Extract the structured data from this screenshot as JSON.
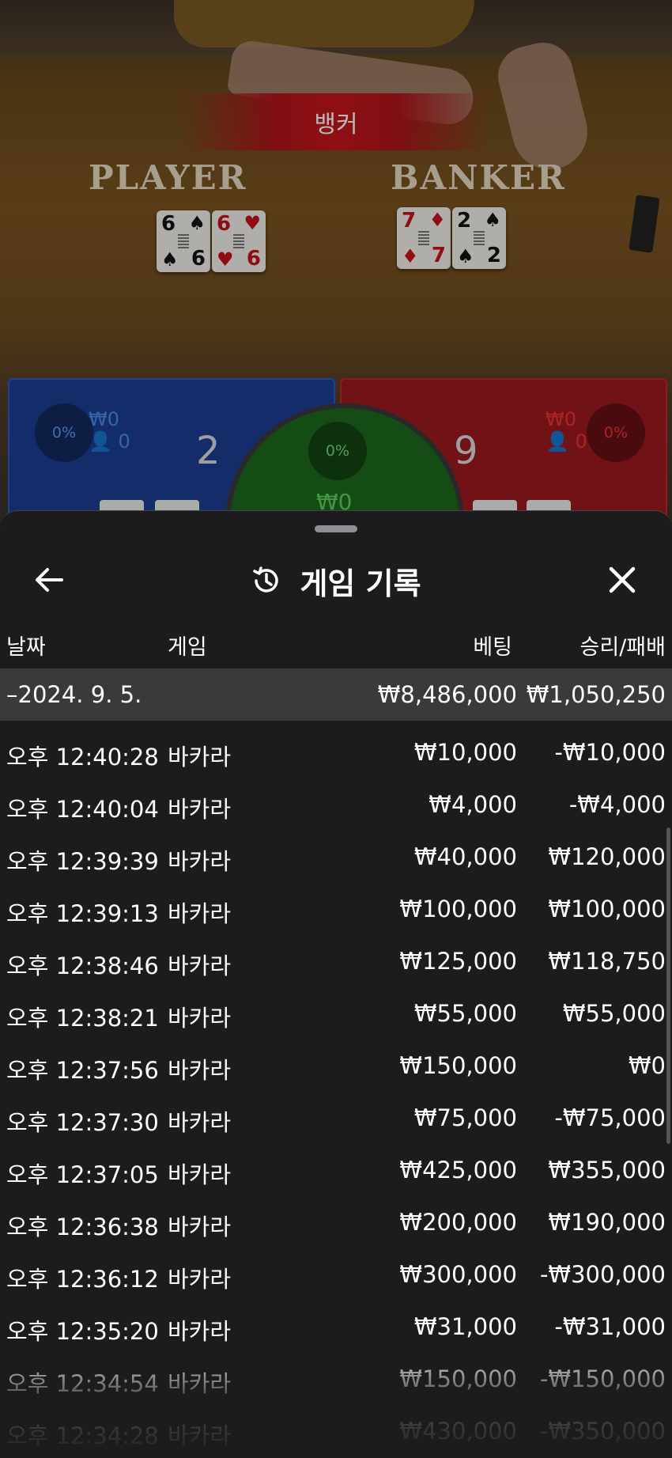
{
  "game_view": {
    "result_banner": "뱅커",
    "player_title": "PLAYER",
    "banker_title": "BANKER",
    "player_cards": [
      {
        "rank": "6",
        "suit": "♠",
        "color": "#111111"
      },
      {
        "rank": "6",
        "suit": "♥",
        "color": "#c8121c"
      }
    ],
    "banker_cards": [
      {
        "rank": "7",
        "suit": "♦",
        "color": "#c8121c"
      },
      {
        "rank": "2",
        "suit": "♠",
        "color": "#111111"
      }
    ],
    "player_panel": {
      "percent": "0%",
      "amount": "₩0",
      "count": "0",
      "score": "2"
    },
    "banker_panel": {
      "percent": "0%",
      "amount": "₩0",
      "count": "0",
      "score": "9"
    },
    "tie_panel": {
      "percent": "0%",
      "amount": "₩0"
    }
  },
  "sheet": {
    "title": "게임 기록",
    "back_icon": "arrow-left-icon",
    "history_icon": "history-clock-icon",
    "close_icon": "close-icon",
    "columns": {
      "date": "날짜",
      "game": "게임",
      "bet": "베팅",
      "result": "승리/패배"
    },
    "date_group": {
      "label": "–2024. 9. 5.",
      "bet_total": "₩8,486,000",
      "result_total": "₩1,050,250"
    },
    "rows": [
      {
        "time": "오후 12:40:28",
        "game": "바카라",
        "bet": "₩10,000",
        "result": "-₩10,000"
      },
      {
        "time": "오후 12:40:04",
        "game": "바카라",
        "bet": "₩4,000",
        "result": "-₩4,000"
      },
      {
        "time": "오후 12:39:39",
        "game": "바카라",
        "bet": "₩40,000",
        "result": "₩120,000"
      },
      {
        "time": "오후 12:39:13",
        "game": "바카라",
        "bet": "₩100,000",
        "result": "₩100,000"
      },
      {
        "time": "오후 12:38:46",
        "game": "바카라",
        "bet": "₩125,000",
        "result": "₩118,750"
      },
      {
        "time": "오후 12:38:21",
        "game": "바카라",
        "bet": "₩55,000",
        "result": "₩55,000"
      },
      {
        "time": "오후 12:37:56",
        "game": "바카라",
        "bet": "₩150,000",
        "result": "₩0"
      },
      {
        "time": "오후 12:37:30",
        "game": "바카라",
        "bet": "₩75,000",
        "result": "-₩75,000"
      },
      {
        "time": "오후 12:37:05",
        "game": "바카라",
        "bet": "₩425,000",
        "result": "₩355,000"
      },
      {
        "time": "오후 12:36:38",
        "game": "바카라",
        "bet": "₩200,000",
        "result": "₩190,000"
      },
      {
        "time": "오후 12:36:12",
        "game": "바카라",
        "bet": "₩300,000",
        "result": "-₩300,000"
      },
      {
        "time": "오후 12:35:20",
        "game": "바카라",
        "bet": "₩31,000",
        "result": "-₩31,000"
      },
      {
        "time": "오후 12:34:54",
        "game": "바카라",
        "bet": "₩150,000",
        "result": "-₩150,000"
      },
      {
        "time": "오후 12:34:28",
        "game": "바카라",
        "bet": "₩430,000",
        "result": "-₩350,000"
      }
    ]
  },
  "colors": {
    "player_panel": "#1d3f93",
    "banker_panel": "#9d1a1f",
    "tie_panel": "#1e6a1e",
    "sheet_background": "#1c1c1e",
    "date_row": "#3a3a3c"
  }
}
